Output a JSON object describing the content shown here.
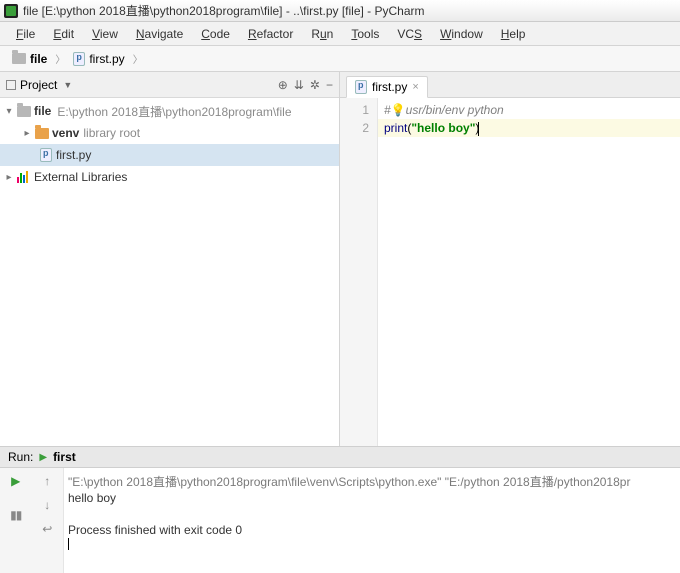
{
  "window": {
    "title": "file [E:\\python 2018直播\\python2018program\\file] - ..\\first.py [file] - PyCharm"
  },
  "menu": [
    "File",
    "Edit",
    "View",
    "Navigate",
    "Code",
    "Refactor",
    "Run",
    "Tools",
    "VCS",
    "Window",
    "Help"
  ],
  "breadcrumb": {
    "folder": "file",
    "file": "first.py"
  },
  "project": {
    "panel_label": "Project",
    "root_name": "file",
    "root_path": "E:\\python 2018直播\\python2018program\\file",
    "venv_name": "venv",
    "venv_note": "library root",
    "file": "first.py",
    "ext_libs": "External Libraries"
  },
  "editor": {
    "tab": "first.py",
    "line_numbers": [
      "1",
      "2"
    ],
    "l1_prefix": "#",
    "l1_rest": "usr/bin/env python",
    "l2_kw": "print",
    "l2_open": "(",
    "l2_str": "\"hello boy\"",
    "l2_close": ")"
  },
  "run": {
    "label": "Run:",
    "config": "first",
    "cmd": "\"E:\\python 2018直播\\python2018program\\file\\venv\\Scripts\\python.exe\" \"E:/python 2018直播/python2018pr",
    "out": "hello boy",
    "blank": " ",
    "exit": "Process finished with exit code 0"
  }
}
